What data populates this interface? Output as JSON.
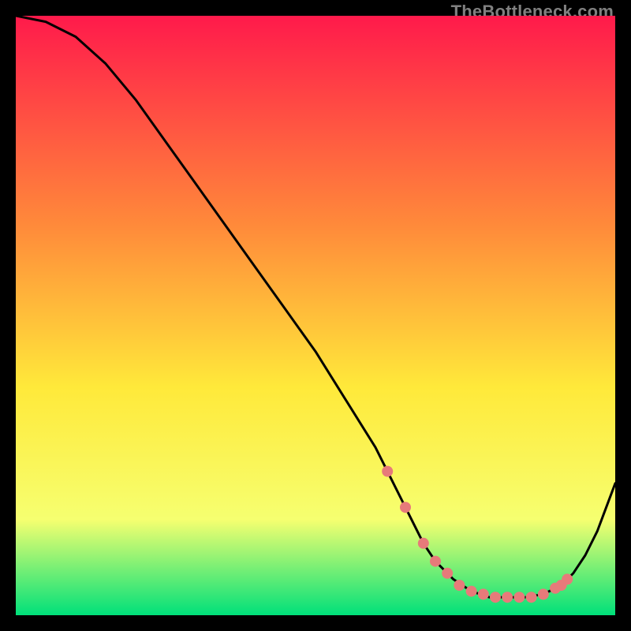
{
  "watermark": "TheBottleneck.com",
  "colors": {
    "gradient_top": "#ff1a4b",
    "gradient_mid1": "#ff8a3a",
    "gradient_mid2": "#ffe93a",
    "gradient_mid3": "#f6ff70",
    "gradient_bottom": "#00e07a",
    "line": "#000000",
    "marker": "#e77a7a",
    "frame": "#000000"
  },
  "chart_data": {
    "type": "line",
    "title": "",
    "xlabel": "",
    "ylabel": "",
    "xlim": [
      0,
      100
    ],
    "ylim": [
      0,
      100
    ],
    "series": [
      {
        "name": "curve",
        "x": [
          0,
          5,
          10,
          15,
          20,
          25,
          30,
          35,
          40,
          45,
          50,
          55,
          60,
          62,
          65,
          68,
          70,
          73,
          76,
          79,
          82,
          85,
          88,
          91,
          93,
          95,
          97,
          100
        ],
        "values": [
          100,
          99,
          96.5,
          92,
          86,
          79,
          72,
          65,
          58,
          51,
          44,
          36,
          28,
          24,
          18,
          12,
          9,
          6,
          4,
          3,
          3,
          3,
          3.5,
          5,
          7,
          10,
          14,
          22
        ]
      }
    ],
    "markers": {
      "name": "highlight-points",
      "x": [
        62,
        65,
        68,
        70,
        72,
        74,
        76,
        78,
        80,
        82,
        84,
        86,
        88,
        90,
        91,
        92
      ],
      "values": [
        24,
        18,
        12,
        9,
        7,
        5,
        4,
        3.5,
        3,
        3,
        3,
        3,
        3.5,
        4.5,
        5,
        6
      ]
    }
  }
}
